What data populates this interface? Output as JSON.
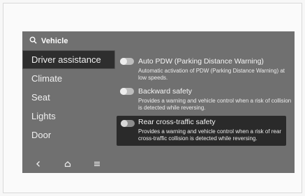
{
  "search": {
    "label": "Vehicle",
    "icon": "search-icon"
  },
  "sidebar": {
    "items": [
      {
        "label": "Driver assistance",
        "active": true
      },
      {
        "label": "Climate",
        "active": false
      },
      {
        "label": "Seat",
        "active": false
      },
      {
        "label": "Lights",
        "active": false
      },
      {
        "label": "Door",
        "active": false
      }
    ]
  },
  "bottom_nav": {
    "buttons": [
      {
        "icon": "back-icon"
      },
      {
        "icon": "home-icon"
      },
      {
        "icon": "menu-icon"
      }
    ]
  },
  "settings": [
    {
      "title": "Auto PDW (Parking Distance Warning)",
      "description": "Automatic activation of PDW (Parking Distance Warning) at low speeds.",
      "enabled": false
    },
    {
      "title": "Backward safety",
      "description": "Provides a warning and vehicle control when a risk of collision is detected while reversing.",
      "enabled": false
    },
    {
      "title": "Rear cross-traffic safety",
      "description": "Provides a warning and vehicle control when a risk of rear cross-traffic collision is detected while reversing.",
      "enabled": false,
      "highlighted": true
    }
  ],
  "colors": {
    "screen_bg": "#707070",
    "active_bg": "#2e2e2e",
    "highlight_bg": "#2a2a2a",
    "text": "#f5f5f5"
  }
}
